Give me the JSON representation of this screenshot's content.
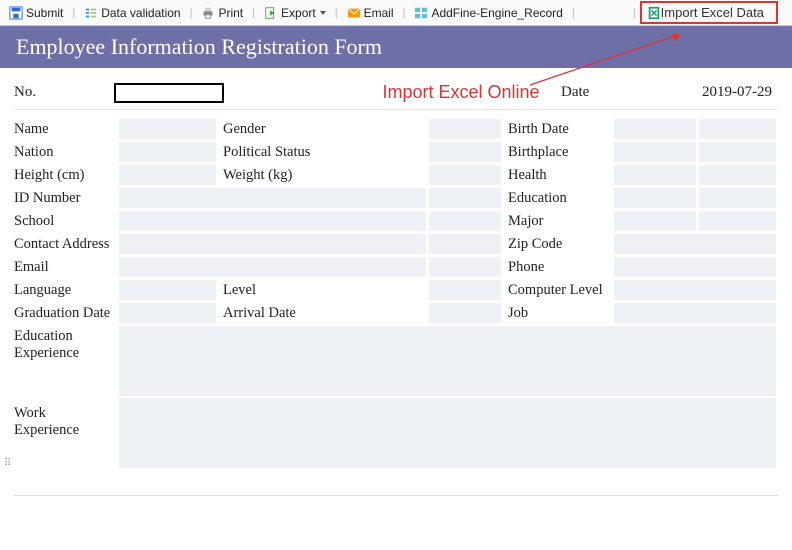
{
  "toolbar": {
    "submit": "Submit",
    "validation": "Data validation",
    "print": "Print",
    "export": "Export",
    "email": "Email",
    "addfine": "AddFine-Engine_Record",
    "import": "Import Excel Data"
  },
  "header": {
    "title": "Employee Information Registration Form"
  },
  "top": {
    "no_label": "No.",
    "annotation": "Import Excel Online",
    "date_label": "Date",
    "date_value": "2019-07-29"
  },
  "labels": {
    "name": "Name",
    "gender": "Gender",
    "birthdate": "Birth Date",
    "nation": "Nation",
    "political": "Political Status",
    "birthplace": "Birthplace",
    "height": "Height (cm)",
    "weight": "Weight (kg)",
    "health": "Health",
    "idnum": "ID Number",
    "education": "Education",
    "school": "School",
    "major": "Major",
    "contact": "Contact Address",
    "zip": "Zip Code",
    "email": "Email",
    "phone": "Phone",
    "language": "Language",
    "level": "Level",
    "complevel": "Computer Level",
    "graddate": "Graduation Date",
    "arrival": "Arrival Date",
    "job": "Job",
    "eduexp1": "Education",
    "eduexp2": "Experience",
    "workexp1": "Work",
    "workexp2": "Experience"
  }
}
